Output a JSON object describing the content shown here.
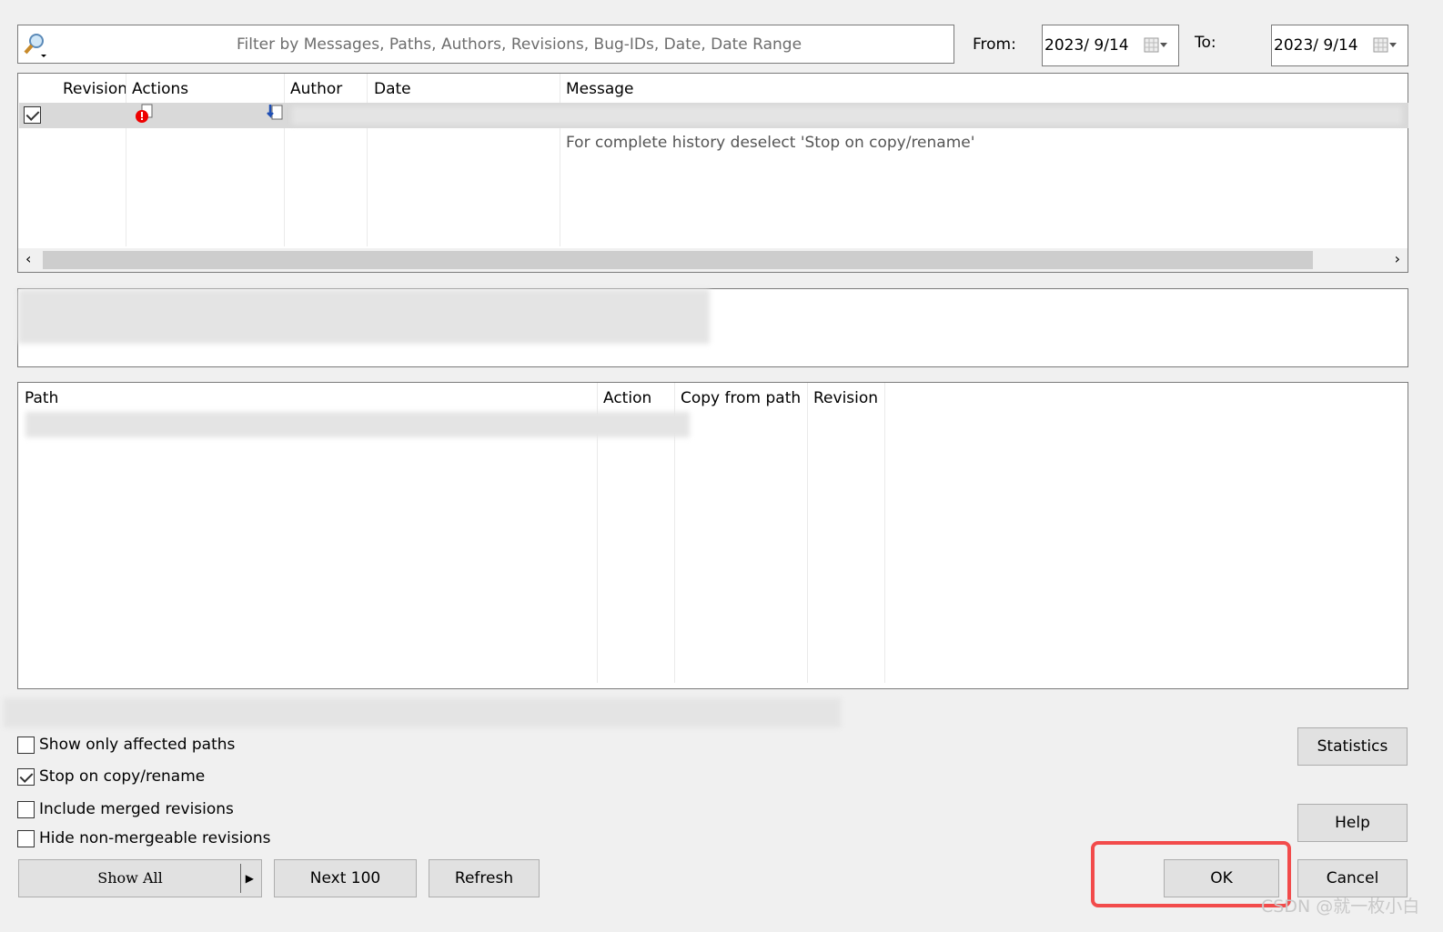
{
  "filter": {
    "placeholder": "Filter by Messages, Paths, Authors, Revisions, Bug-IDs, Date, Date Range",
    "icon": "search-icon"
  },
  "from": {
    "label": "From:",
    "value": "2023/  9/14"
  },
  "to": {
    "label": "To:",
    "value": "2023/  9/14"
  },
  "log_table": {
    "columns": [
      "Revision",
      "Actions",
      "Author",
      "Date",
      "Message"
    ],
    "row_checked": true,
    "note": "For complete history deselect 'Stop on copy/rename'"
  },
  "paths_table": {
    "columns": [
      "Path",
      "Action",
      "Copy from path",
      "Revision"
    ]
  },
  "options": [
    {
      "label": "Show only affected paths",
      "checked": false
    },
    {
      "label": "Stop on copy/rename",
      "checked": true
    },
    {
      "label": "Include merged revisions",
      "checked": false
    },
    {
      "label": "Hide non-mergeable revisions",
      "checked": false
    }
  ],
  "buttons": {
    "show_all": "Show All",
    "next_100": "Next 100",
    "refresh": "Refresh",
    "statistics": "Statistics",
    "help": "Help",
    "ok": "OK",
    "cancel": "Cancel"
  },
  "highlight_color": "#f24b4b",
  "watermark": "CSDN @就一枚小白"
}
